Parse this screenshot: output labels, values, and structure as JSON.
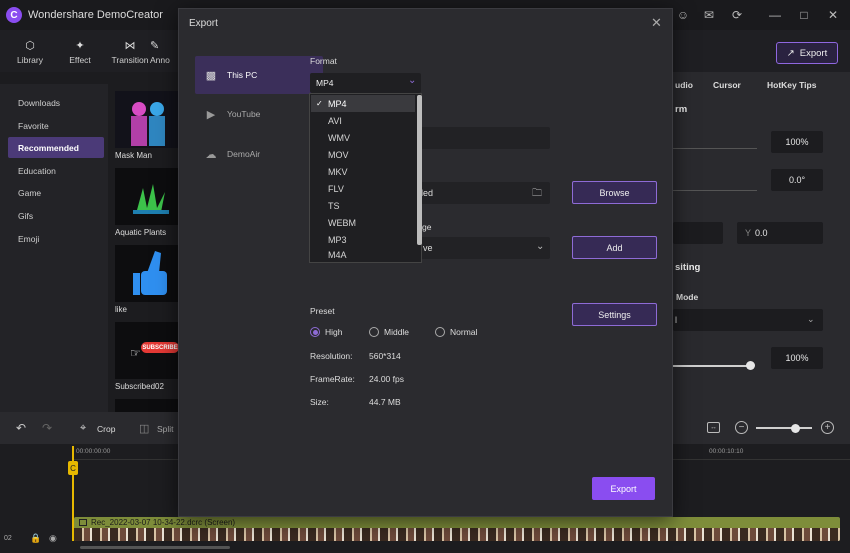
{
  "app": {
    "title": "Wondershare DemoCreator",
    "logo_letter": "C"
  },
  "toolbar": {
    "items": [
      {
        "label": "Library",
        "icon": "cube-icon"
      },
      {
        "label": "Effect",
        "icon": "magic-wand-icon"
      },
      {
        "label": "Transition",
        "icon": "transition-icon"
      },
      {
        "label": "Anno",
        "icon": "annotation-icon"
      }
    ],
    "export_label": "Export"
  },
  "sidebar": {
    "items": [
      {
        "label": "Downloads"
      },
      {
        "label": "Favorite"
      },
      {
        "label": "Recommended",
        "active": true
      },
      {
        "label": "Education"
      },
      {
        "label": "Game"
      },
      {
        "label": "Gifs"
      },
      {
        "label": "Emoji"
      }
    ]
  },
  "library": {
    "items": [
      {
        "label": "Mask Man"
      },
      {
        "label": "Aquatic Plants"
      },
      {
        "label": "like"
      },
      {
        "label": "Subscribed02"
      }
    ],
    "subscribe_text": "SUBSCRIBE"
  },
  "right_panel": {
    "tabs": [
      "udio",
      "Cursor",
      "HotKey Tips"
    ],
    "section1": "rm",
    "scale_value": "100%",
    "rotate_value": "0.0°",
    "y_label": "Y",
    "y_value": "0.0",
    "section2": "siting",
    "mode_label": "Mode",
    "mode_value": "l",
    "opacity_value": "100%"
  },
  "timeline": {
    "crop_label": "Crop",
    "split_label": "Split",
    "time_start": "00:00:00:00",
    "time_mid": "00:00:10:10",
    "track_number": "02",
    "clip_label": "Rec_2022-03-07 10-34-22.dcrc (Screen)",
    "playhead_label": "C"
  },
  "export_dialog": {
    "title": "Export",
    "destinations": [
      {
        "label": "This PC",
        "active": true
      },
      {
        "label": "YouTube"
      },
      {
        "label": "DemoAir"
      }
    ],
    "format_label": "Format",
    "format_value": "MP4",
    "format_options": [
      "MP4",
      "AVI",
      "WMV",
      "MOV",
      "MKV",
      "FLV",
      "TS",
      "WEBM",
      "MP3",
      "M4A"
    ],
    "selected_format": "MP4",
    "location_value_partial": "ded",
    "language_label_partial": "ge",
    "language_value_partial": "ve",
    "browse_label": "Browse",
    "add_label": "Add",
    "settings_label": "Settings",
    "preset_label": "Preset",
    "presets": [
      {
        "label": "High",
        "selected": true
      },
      {
        "label": "Middle"
      },
      {
        "label": "Normal"
      }
    ],
    "resolution_label": "Resolution:",
    "resolution_value": "560*314",
    "framerate_label": "FrameRate:",
    "framerate_value": "24.00 fps",
    "size_label": "Size:",
    "size_value": "44.7 MB",
    "export_label": "Export"
  },
  "colors": {
    "accent": "#8a4df0",
    "active_item": "#4b3a78",
    "clip": "#7e8d3a"
  }
}
